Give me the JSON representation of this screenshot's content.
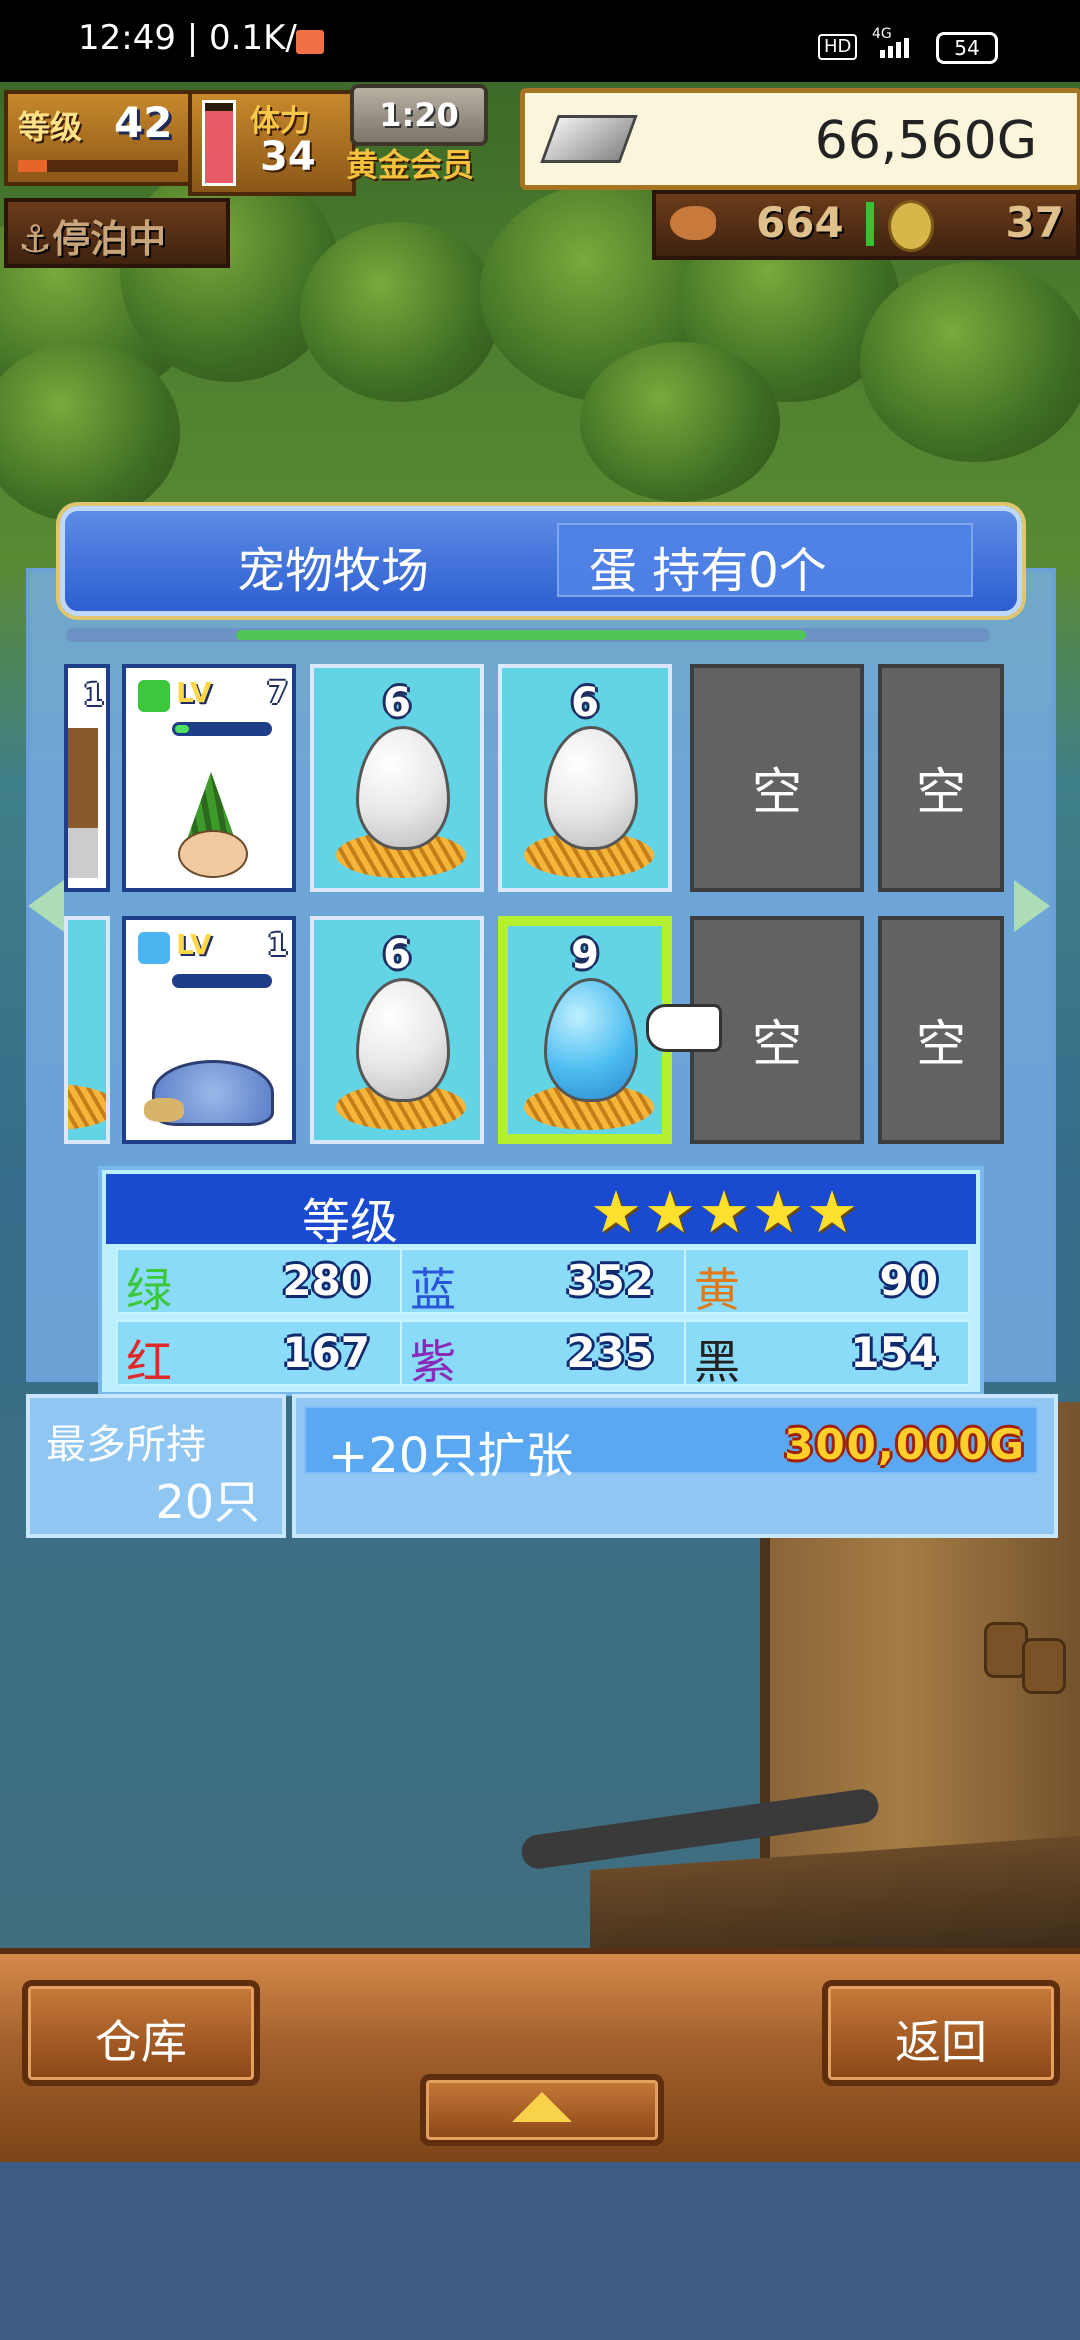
{
  "status_bar": {
    "time": "12:49 | 0.1K/s",
    "hd": "HD",
    "network": "4G",
    "battery": "54"
  },
  "hud": {
    "level_label": "等级",
    "level_value": "42",
    "stamina_label": "体力",
    "stamina_value": "34",
    "timer": "1:20",
    "membership": "黄金会员",
    "money": "66,560G",
    "status": "停泊中",
    "food": "664",
    "coins": "37"
  },
  "ranch": {
    "title": "宠物牧场",
    "egg_count": "蛋 持有0个",
    "empty_label": "空",
    "row1": [
      {
        "type": "pet-partial",
        "level": "1"
      },
      {
        "type": "pet",
        "lv_label": "LV",
        "level": "7",
        "element": "green"
      },
      {
        "type": "egg",
        "num": "6"
      },
      {
        "type": "egg",
        "num": "6"
      },
      {
        "type": "empty"
      },
      {
        "type": "empty"
      }
    ],
    "row2": [
      {
        "type": "pet-partial"
      },
      {
        "type": "pet",
        "lv_label": "LV",
        "level": "1",
        "element": "blue"
      },
      {
        "type": "egg",
        "num": "6"
      },
      {
        "type": "egg",
        "num": "9",
        "selected": true
      },
      {
        "type": "empty"
      },
      {
        "type": "empty"
      }
    ]
  },
  "stats": {
    "rank_label": "等级",
    "stars": "★★★★★",
    "items": [
      {
        "key": "绿",
        "value": "280",
        "color": "#3cc83c"
      },
      {
        "key": "蓝",
        "value": "352",
        "color": "#2a56d8"
      },
      {
        "key": "黄",
        "value": "90",
        "color": "#e07a18"
      },
      {
        "key": "红",
        "value": "167",
        "color": "#e02828"
      },
      {
        "key": "紫",
        "value": "235",
        "color": "#8a2ab8"
      },
      {
        "key": "黑",
        "value": "154",
        "color": "#222222"
      }
    ]
  },
  "capacity": {
    "label": "最多所持",
    "value": "20只"
  },
  "expand": {
    "label": "+20只扩张",
    "price": "300,000G"
  },
  "buttons": {
    "warehouse": "仓库",
    "back": "返回"
  }
}
